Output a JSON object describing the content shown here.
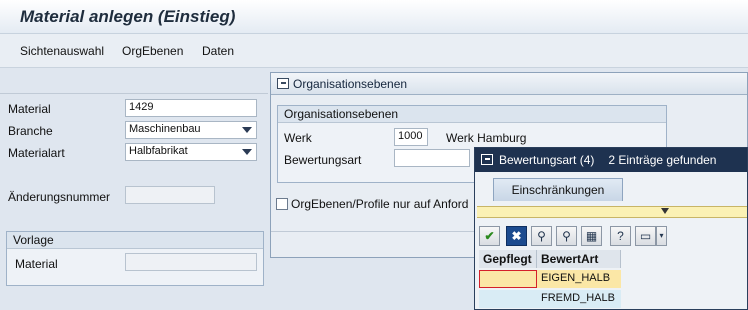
{
  "window": {
    "title": "Material anlegen (Einstieg)"
  },
  "menu": {
    "items": [
      "Sichtenauswahl",
      "OrgEbenen",
      "Daten"
    ]
  },
  "main": {
    "material_label": "Material",
    "material_value": "1429",
    "branche_label": "Branche",
    "branche_value": "Maschinenbau",
    "materialart_label": "Materialart",
    "materialart_value": "Halbfabrikat",
    "aenderungsnummer_label": "Änderungsnummer",
    "aenderungsnummer_value": "",
    "vorlage": {
      "title": "Vorlage",
      "material_label": "Material",
      "material_value": ""
    }
  },
  "org_dialog": {
    "title": "Organisationsebenen",
    "group_title": "Organisationsebenen",
    "werk_label": "Werk",
    "werk_value": "1000",
    "werk_text": "Werk Hamburg",
    "bewertungsart_label": "Bewertungsart",
    "bewertungsart_value": "",
    "checkbox_label": "OrgEbenen/Profile nur auf Anford",
    "checkbox_checked": false
  },
  "search_help": {
    "title": "Bewertungsart (4)",
    "found_text": "2 Einträge gefunden",
    "tab_label": "Einschränkungen",
    "columns": [
      "Gepflegt",
      "BewertArt"
    ],
    "rows": [
      {
        "gepflegt": "",
        "bewertart": "EIGEN_HALB"
      },
      {
        "gepflegt": "",
        "bewertart": "FREMD_HALB"
      }
    ],
    "toolbar_icons": [
      "check-icon",
      "cancel-icon",
      "binoculars-icon",
      "binoculars-next-icon",
      "selection-icon",
      "info-icon",
      "print-icon",
      "dropdown-icon"
    ],
    "colors": {
      "selected_row": "#fbe7a6",
      "row": "#d9ecf5",
      "header": "#1e3250"
    }
  }
}
